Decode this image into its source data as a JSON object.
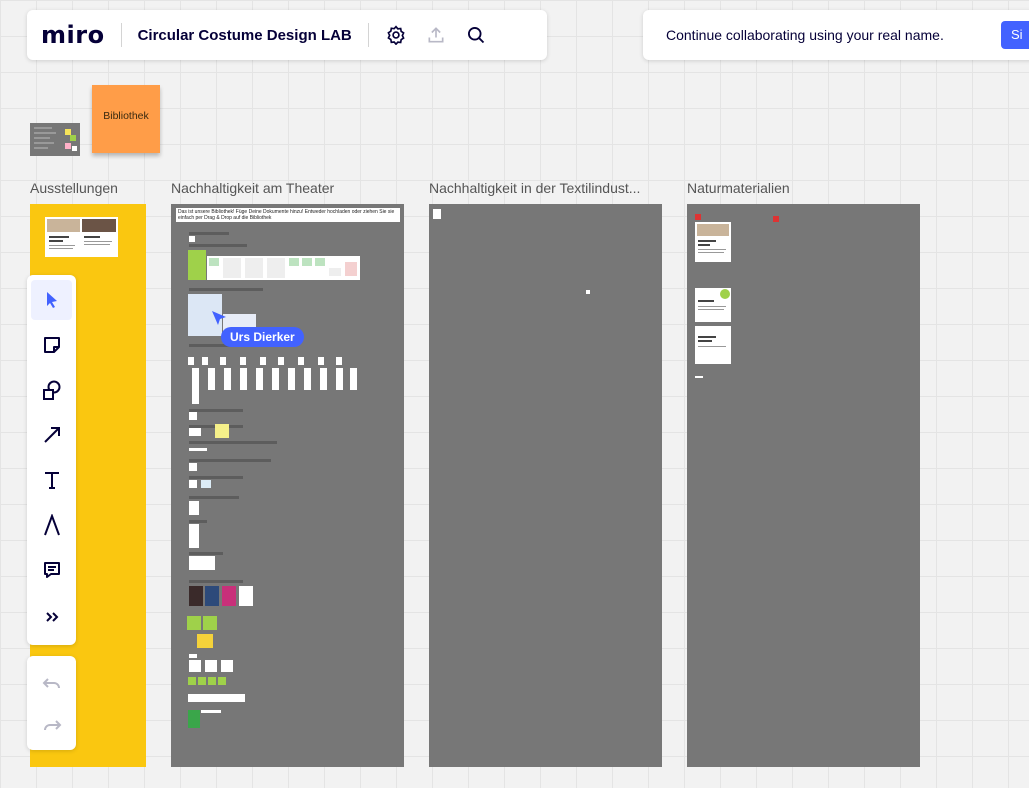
{
  "app": {
    "logo": "miro",
    "board_title": "Circular Costume Design LAB"
  },
  "header_icons": [
    "settings-icon",
    "share-upload-icon",
    "search-icon"
  ],
  "collab_banner": {
    "text": "Continue collaborating using your real name.",
    "button_label": "Si"
  },
  "library": {
    "sticky_label": "Bibliothek"
  },
  "frames": [
    {
      "title": "Ausstellungen"
    },
    {
      "title": "Nachhaltigkeit am Theater"
    },
    {
      "title": "Nachhaltigkeit in der Textilindust..."
    },
    {
      "title": "Naturmaterialien"
    }
  ],
  "theater_note": "Das ist unsere Bibliothek! Füge Deine Dokumente hinzu! Entweder hochladen oder ziehen Sie sie einfach per Drag & Drop auf die Bibliothek",
  "collaborator": {
    "name": "Urs Dierker",
    "color": "#4262ff"
  },
  "toolbar": {
    "tools": [
      "select-tool",
      "sticky-note-tool",
      "shapes-tool",
      "connection-line-tool",
      "text-tool",
      "pen-tool",
      "comment-tool",
      "more-tools"
    ],
    "active_tool": "select-tool"
  },
  "colors": {
    "accent": "#4262ff",
    "frame_gray": "#777777",
    "frame_yellow": "#fac710",
    "sticky_orange": "#ff9d48"
  }
}
